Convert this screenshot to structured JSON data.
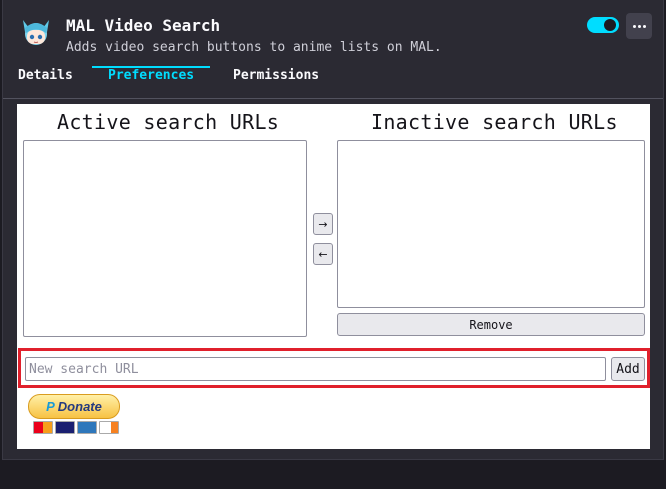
{
  "addon": {
    "name": "MAL Video Search",
    "description": "Adds video search buttons to anime lists on MAL.",
    "enabled": true
  },
  "tabs": [
    {
      "label": "Details",
      "active": false
    },
    {
      "label": "Preferences",
      "active": true
    },
    {
      "label": "Permissions",
      "active": false
    }
  ],
  "prefs": {
    "active_title": "Active search URLs",
    "inactive_title": "Inactive search URLs",
    "active_urls": [],
    "inactive_urls": [],
    "move_right": "→",
    "move_left": "←",
    "remove_label": "Remove",
    "new_url_placeholder": "New search URL",
    "new_url_value": "",
    "add_label": "Add",
    "donate_label": "Donate",
    "paypal_mark": "P"
  },
  "icons": [
    "addon-mascot-icon",
    "more-options-icon",
    "arrow-right-icon",
    "arrow-left-icon",
    "paypal-icon",
    "mastercard-icon",
    "visa-icon",
    "amex-icon",
    "discover-icon"
  ],
  "colors": {
    "accent": "#00ddff",
    "highlight_border": "#e0202c",
    "card_bg": "#2b2a33"
  }
}
